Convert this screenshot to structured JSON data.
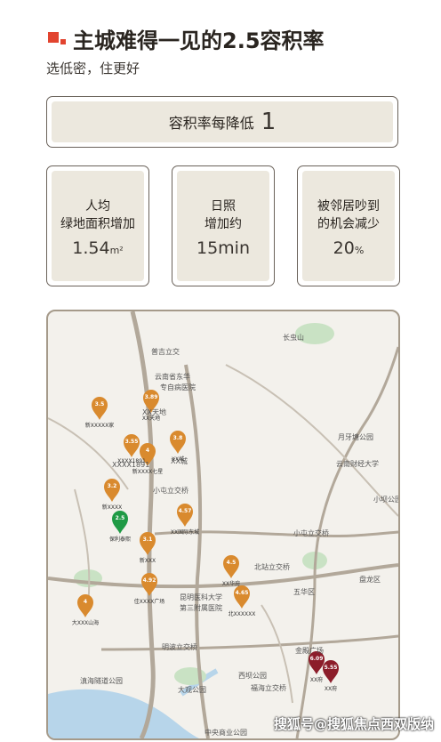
{
  "header": {
    "title": "主城难得一见的2.5容积率",
    "subtitle": "选低密，住更好",
    "logo_color": "#e2442f"
  },
  "banner": {
    "text": "容积率每降低",
    "number": "1"
  },
  "stats": [
    {
      "line1": "人均",
      "line2": "绿地面积增加",
      "value": "1.54",
      "unit": "m²"
    },
    {
      "line1": "日照",
      "line2": "增加约",
      "value": "15min",
      "unit": ""
    },
    {
      "line1": "被邻居吵到",
      "line2": "的机会减少",
      "value": "20",
      "unit": "%"
    }
  ],
  "map": {
    "labels": [
      "长虫山",
      "普吉立交",
      "云南省东华",
      "专自病医院",
      "XX天地",
      "XX城",
      "XXXX1891",
      "小屯立交桥",
      "月牙塘公园",
      "云南财经大学",
      "小坝公园",
      "小屯立交桥",
      "北站立交桥",
      "五华区",
      "盘龙区",
      "昆明医科大学",
      "第三附属医院",
      "明波立交桥",
      "金殿广场",
      "滇海隧道公园",
      "大观公园",
      "西坝公园",
      "福海立交桥",
      "中央商业公园"
    ],
    "pins": [
      {
        "value": "3.5",
        "label": "新XXXXX家"
      },
      {
        "value": "3.89",
        "label": "XX天地"
      },
      {
        "value": "3.55",
        "label": "XXXX1891"
      },
      {
        "value": "4",
        "label": "新XXXX七星"
      },
      {
        "value": "3.8",
        "label": "XX城"
      },
      {
        "value": "3.2",
        "label": "新XXXX"
      },
      {
        "value": "2.5",
        "label": "保利泰熙"
      },
      {
        "value": "4.57",
        "label": "XX国际东城"
      },
      {
        "value": "3.1",
        "label": "新XXX"
      },
      {
        "value": "4.5",
        "label": "XX华府"
      },
      {
        "value": "4.92",
        "label": "佳XXXX广场"
      },
      {
        "value": "4.65",
        "label": "北XXXXXX"
      },
      {
        "value": "4",
        "label": "大XXX山海"
      },
      {
        "value": "6.09",
        "label": "XX府"
      },
      {
        "value": "5.55",
        "label": "XX府"
      }
    ],
    "colors": {
      "orange": "#d98a2e",
      "green": "#1f9a45",
      "red": "#8c1d2a",
      "road": "#b2a89a",
      "water": "#b7d5ea",
      "park": "#c9e2c4"
    }
  },
  "watermark": "搜狐号@搜狐焦点西双版纳"
}
